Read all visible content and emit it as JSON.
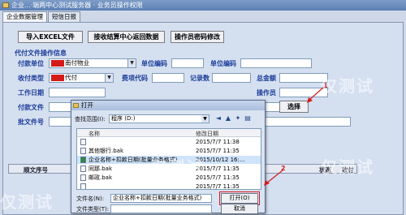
{
  "window": {
    "title": "企业...·端两中心测试服务器 · 业务员操作权限"
  },
  "tabs": [
    {
      "label": "企业数据管理"
    },
    {
      "label": "短信日报"
    }
  ],
  "toolbar": {
    "import_label": "导入EXCEL文件",
    "receive_label": "接收结算中心返回数据",
    "password_label": "操作员密码修改"
  },
  "form": {
    "section_title": "代付文件操作信息",
    "labels": {
      "payer_unit": "付款单位",
      "unit_no1": "单位编码",
      "unit_no2": "单位编码",
      "collect_type": "收付类型",
      "fee_code": "费项代码",
      "record_count": "记录数",
      "total_amount": "总金额",
      "operator": "操作员",
      "business_no": "工作日期",
      "payee_file": "付款文件",
      "batch_file": "批文件号"
    },
    "values": {
      "payer_unit": "南付物业",
      "collect_type": "代付"
    },
    "select_label": "选择"
  },
  "grid": {
    "headers": [
      "顺文序号",
      "状态",
      "收付"
    ]
  },
  "dialog": {
    "title": "打开",
    "lookin_label": "查找范围(I):",
    "lookin_value": "程序 (D:)",
    "col_name": "名称",
    "col_date": "修改日期",
    "files": [
      {
        "name": "",
        "date": "2015/7/7 11:38"
      },
      {
        "name": "其他银行.bak",
        "date": "2015/7/7 11:35"
      },
      {
        "name": "企业名称+扣款日期(批量业务格式)",
        "date": "2015/10/12 16:..."
      },
      {
        "name": "同那.bak",
        "date": "2015/7/7 11:35"
      },
      {
        "name": "邮政.bak",
        "date": "2015/7/7 11:35"
      },
      {
        "name": "",
        "date": "2015/7/7 11:35"
      }
    ],
    "filename_label": "文件名(N):",
    "filename_value": "企业名称+扣款日期(批量业务格式)",
    "filetype_label": "文件类型(T):",
    "open_label": "打开(O)",
    "cancel_label": "取消"
  },
  "annotations": {
    "step1": "1",
    "step2": "2"
  },
  "watermark": {
    "text": "仅测试"
  },
  "colors": {
    "label_blue": "#1c3d99",
    "annotation_red": "#d51a1a",
    "panel_bg": "#d4dff0"
  }
}
